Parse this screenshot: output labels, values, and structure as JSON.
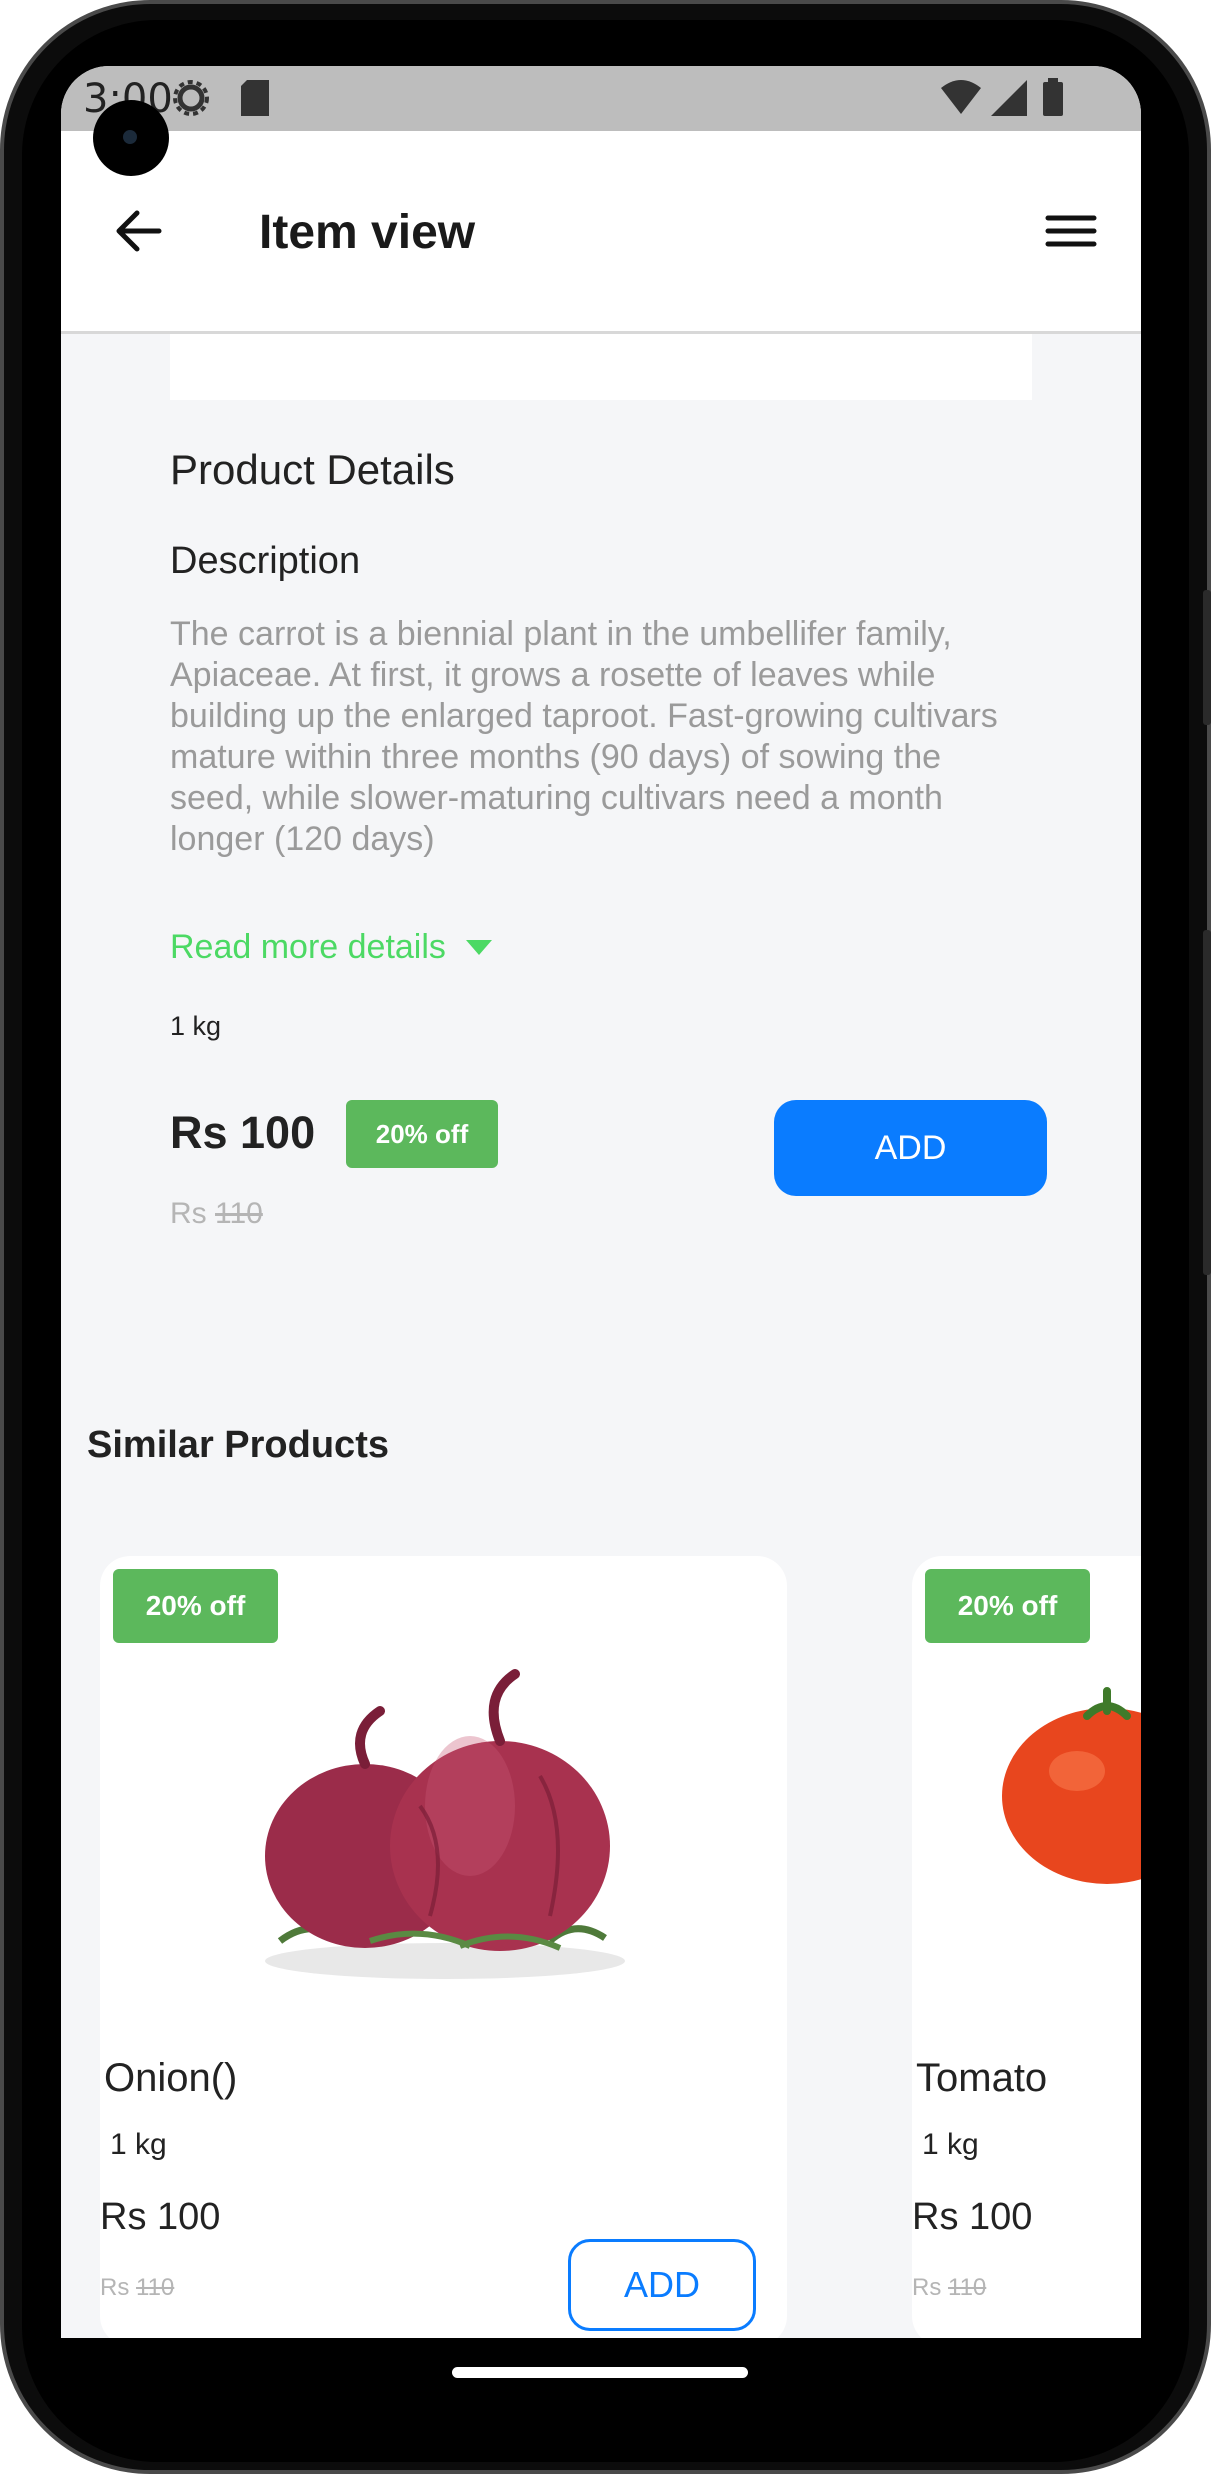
{
  "status_bar": {
    "time": "3:00"
  },
  "app_bar": {
    "title": "Item view"
  },
  "product": {
    "section_title": "Product Details",
    "description_label": "Description",
    "description": "The carrot is a biennial plant in the umbellifer family, Apiaceae. At first, it grows a rosette of leaves while building up the enlarged taproot. Fast-growing cultivars mature within three months (90 days) of sowing the seed, while slower-maturing cultivars need a month longer (120 days)",
    "read_more": "Read more details",
    "quantity": "1 kg",
    "price": "Rs 100",
    "discount": "20% off",
    "old_price_currency": "Rs",
    "old_price_value": "110",
    "add_label": "ADD"
  },
  "similar": {
    "title": "Similar Products",
    "items": [
      {
        "name": "Onion()",
        "quantity": "1 kg",
        "price": "Rs 100",
        "old_price_currency": "Rs",
        "old_price_value": "110",
        "discount": "20% off",
        "add_label": "ADD",
        "image": "onion"
      },
      {
        "name": "Tomato",
        "quantity": "1 kg",
        "price": "Rs 100",
        "old_price_currency": "Rs",
        "old_price_value": "110",
        "discount": "20% off",
        "image": "tomato"
      }
    ]
  },
  "colors": {
    "primary": "#0a7cff",
    "discount": "#5cb85c",
    "link": "#4cd964",
    "background": "#f5f6f8"
  },
  "icons": [
    "gear-icon",
    "sd-card-icon",
    "wifi-icon",
    "signal-icon",
    "battery-icon",
    "back-arrow-icon",
    "menu-icon",
    "caret-down-icon"
  ]
}
